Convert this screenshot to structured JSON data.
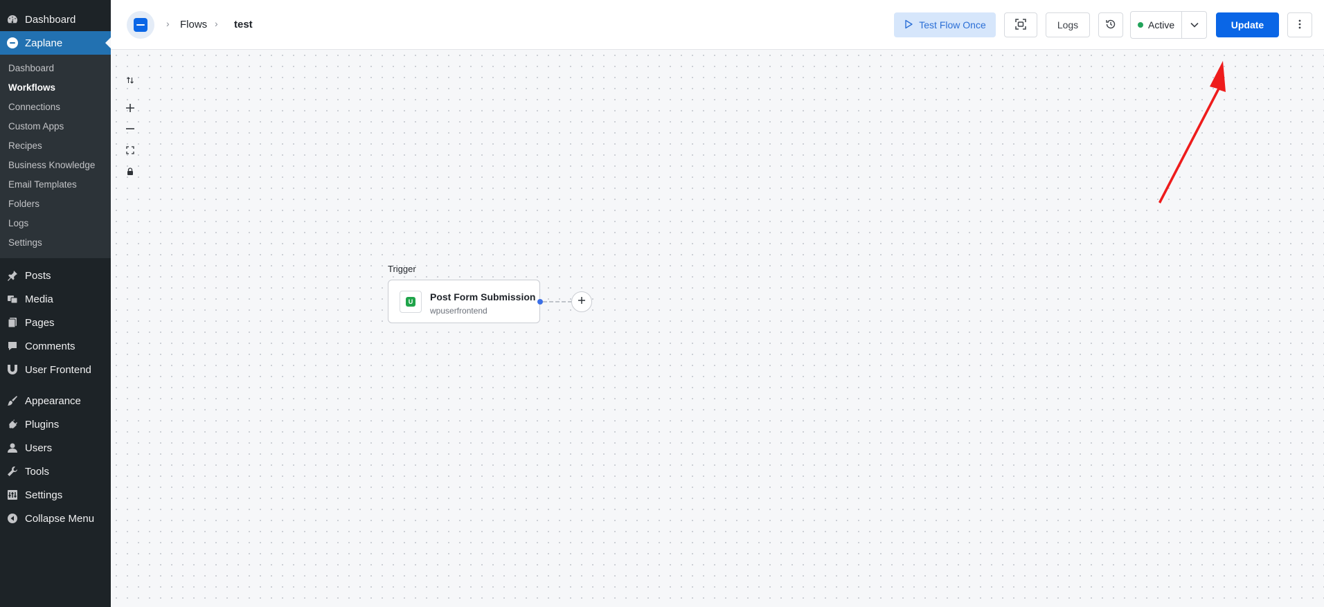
{
  "wp_sidebar": {
    "dashboard": "Dashboard",
    "current_plugin": "Zaplane",
    "submenu": [
      "Dashboard",
      "Workflows",
      "Connections",
      "Custom Apps",
      "Recipes",
      "Business Knowledge",
      "Email Templates",
      "Folders",
      "Logs",
      "Settings"
    ],
    "active_submenu": "Workflows",
    "menu": [
      "Posts",
      "Media",
      "Pages",
      "Comments",
      "User Frontend",
      "Appearance",
      "Plugins",
      "Users",
      "Tools",
      "Settings",
      "Collapse Menu"
    ]
  },
  "topbar": {
    "breadcrumb": [
      "Flows",
      "test"
    ],
    "test_flow_label": "Test Flow Once",
    "logs_label": "Logs",
    "status_label": "Active",
    "update_label": "Update"
  },
  "canvas": {
    "trigger_label": "Trigger",
    "node": {
      "title": "Post Form Submission",
      "subtitle": "wpuserfrontend",
      "icon_letter": "U"
    }
  },
  "colors": {
    "accent": "#0a66e6",
    "wp_current": "#2271b1",
    "status_active": "#22a35a",
    "annotation": "#ee1c1c"
  }
}
